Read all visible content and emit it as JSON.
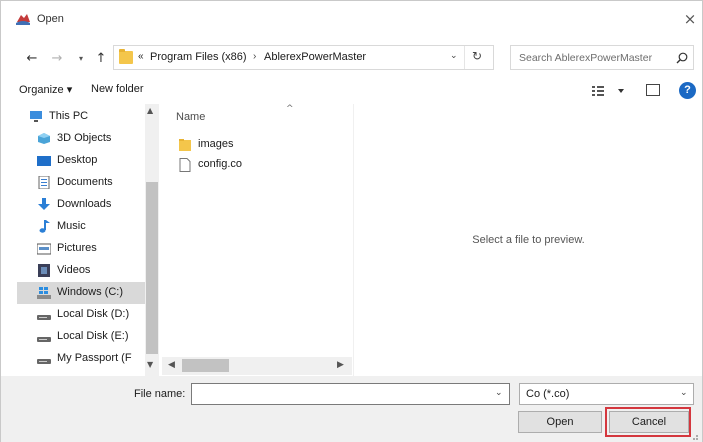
{
  "window": {
    "title": "Open",
    "close_glyph": "×"
  },
  "navigation": {
    "back_glyph": "←",
    "forward_glyph": "→",
    "recent_glyph": "▾",
    "up_glyph": "↑"
  },
  "address": {
    "overflow": "«",
    "segments": [
      "Program Files (x86)",
      "AblerexPowerMaster"
    ],
    "separator": "›",
    "dropdown_glyph": "⌄",
    "refresh_glyph": "↻"
  },
  "search": {
    "placeholder": "Search AblerexPowerMaster"
  },
  "toolbar": {
    "organize_label": "Organize ▾",
    "new_folder_label": "New folder",
    "help_label": "?"
  },
  "nav_pane": {
    "items": [
      {
        "label": "This PC",
        "icon": "computer-icon"
      },
      {
        "label": "3D Objects",
        "icon": "3d-objects-icon"
      },
      {
        "label": "Desktop",
        "icon": "desktop-icon"
      },
      {
        "label": "Documents",
        "icon": "documents-icon"
      },
      {
        "label": "Downloads",
        "icon": "downloads-icon"
      },
      {
        "label": "Music",
        "icon": "music-icon"
      },
      {
        "label": "Pictures",
        "icon": "pictures-icon"
      },
      {
        "label": "Videos",
        "icon": "videos-icon"
      },
      {
        "label": "Windows (C:)",
        "icon": "windows-drive-icon",
        "selected": true
      },
      {
        "label": "Local Disk (D:)",
        "icon": "drive-icon"
      },
      {
        "label": "Local Disk (E:)",
        "icon": "drive-icon"
      },
      {
        "label": "My Passport (F",
        "icon": "drive-icon"
      }
    ]
  },
  "file_list": {
    "column_name": "Name",
    "sort_glyph": "^",
    "files": [
      {
        "name": "images",
        "type": "folder"
      },
      {
        "name": "config.co",
        "type": "file"
      }
    ]
  },
  "preview": {
    "message": "Select a file to preview."
  },
  "bottom": {
    "file_name_label": "File name:",
    "file_name_value": "",
    "filter_value": "Co (*.co)",
    "open_label": "Open",
    "cancel_label": "Cancel"
  },
  "colors": {
    "selection": "#d9d9d9",
    "highlight_border": "#d4373e",
    "help_blue": "#1b69c4",
    "folder_yellow": "#f4c64b"
  }
}
